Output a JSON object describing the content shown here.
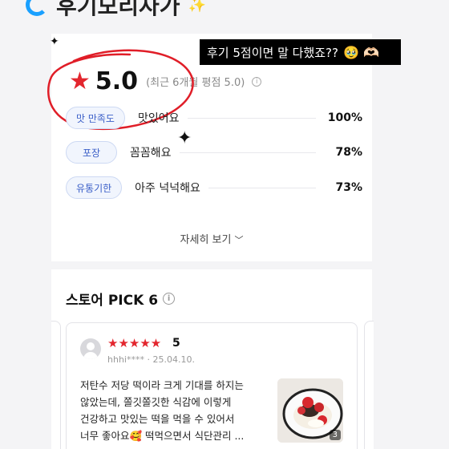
{
  "header": {
    "title": "후기모리자가"
  },
  "sticker": {
    "text": "후기 5점이면 말 다했죠??",
    "emoji": "🥹 🫶🏻"
  },
  "rating": {
    "score": "5.0",
    "subtitle": "(최근 6개월 평점 5.0)"
  },
  "criteria": [
    {
      "tag": "맛 만족도",
      "text": "맛있어요",
      "pct": "100%",
      "value": 100
    },
    {
      "tag": "포장",
      "text": "꼼꼼해요",
      "pct": "78%",
      "value": 78
    },
    {
      "tag": "유통기한",
      "text": "아주 넉넉해요",
      "pct": "73%",
      "value": 73
    }
  ],
  "detail_link": "자세히 보기",
  "pick": {
    "title": "스토어 PICK 6"
  },
  "review": {
    "rating": "5",
    "user": "hhhi****",
    "date": "25.04.10.",
    "lines": [
      "저탄수 저당 떡이라 크게 기대를 하지는",
      "않았는데, 쫄깃쫄깃한 식감에 이렇게",
      "건강하고 맛있는 떡을 먹을 수 있어서",
      "너무 좋아요🥰 떡먹으면서 식단관리 ..."
    ],
    "photo_count": "3"
  },
  "colors": {
    "accent_red": "#e3262e",
    "tag_blue": "#3b5fc8"
  }
}
